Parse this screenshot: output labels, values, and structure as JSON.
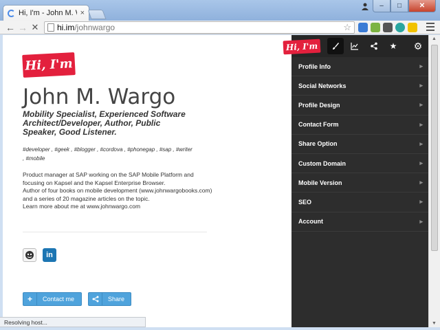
{
  "browser": {
    "tab_title": "Hi, I'm - John M. Wargo (j",
    "tab_close": "×",
    "url_host": "hi.im",
    "url_path": "/johnwargo",
    "status_text": "Resolving host...",
    "window_buttons": {
      "minimize": "–",
      "maximize": "□",
      "close": "✕"
    }
  },
  "page": {
    "logo_text": "Hi, I'm",
    "name": "John M. Wargo",
    "tagline": "Mobility Specialist, Experienced Software Architect/Developer, Author, Public Speaker, Good Listener.",
    "tags": "#developer , #geek , #blogger , #cordova , #phonegap , #sap , #writer , #mobile",
    "bio": [
      "Product manager at SAP working on the SAP Mobile Platform and focusing on Kapsel and the Kapsel Enterprise Browser.",
      "Author of four books on mobile development (www.johnwargobooks.com) and a series of 20 magazine articles on the topic.",
      "Learn more about me at www.johnwargo.com"
    ],
    "social": {
      "linkedin_label": "in"
    },
    "buttons": {
      "contact": "Contact me",
      "share": "Share"
    }
  },
  "panel": {
    "logo_text": "Hi, I'm",
    "menu": [
      {
        "label": "Profile Info"
      },
      {
        "label": "Social Networks"
      },
      {
        "label": "Profile Design"
      },
      {
        "label": "Contact Form"
      },
      {
        "label": "Share Option"
      },
      {
        "label": "Custom Domain"
      },
      {
        "label": "Mobile Version"
      },
      {
        "label": "SEO"
      },
      {
        "label": "Account"
      }
    ]
  },
  "colors": {
    "brand_red": "#e3203d",
    "panel_bg": "#2d2d2d",
    "button_blue": "#4fa3dc"
  }
}
